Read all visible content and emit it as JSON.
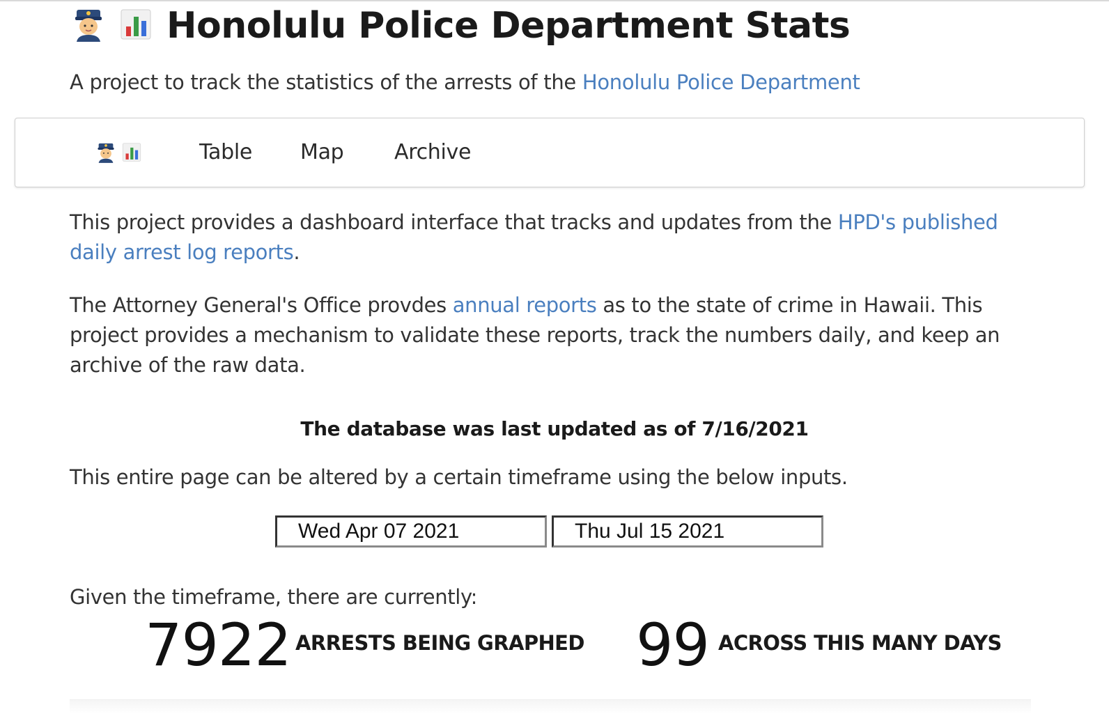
{
  "header": {
    "title": "Honolulu Police Department Stats",
    "icons": [
      "police-officer-icon",
      "bar-chart-icon"
    ],
    "subtitle_prefix": "A project to track the statistics of the arrests of the ",
    "subtitle_link": "Honolulu Police Department"
  },
  "nav": {
    "brand_icons": [
      "police-officer-icon",
      "bar-chart-icon"
    ],
    "items": [
      {
        "label": "Table"
      },
      {
        "label": "Map"
      },
      {
        "label": "Archive"
      }
    ]
  },
  "intro": {
    "p1_prefix": "This project provides a dashboard interface that tracks and updates from the ",
    "p1_link": "HPD's published daily arrest log reports",
    "p1_suffix": ".",
    "p2_prefix": "The Attorney General's Office provdes ",
    "p2_link": "annual reports",
    "p2_suffix": " as to the state of crime in Hawaii. This project provides a mechanism to validate these reports, track the numbers daily, and keep an archive of the raw data."
  },
  "status": {
    "updated_text": "The database was last updated as of 7/16/2021",
    "alter_text": "This entire page can be altered by a certain timeframe using the below inputs."
  },
  "timeframe": {
    "start_value": "Wed Apr 07 2021",
    "end_value": "Thu Jul 15 2021"
  },
  "summary": {
    "given_text": "Given the timeframe, there are currently:",
    "arrests_count": "7922",
    "arrests_label": "ARRESTS BEING GRAPHED",
    "days_count": "99",
    "days_label": "ACROSS THIS MANY DAYS"
  },
  "colors": {
    "link": "#4a7fbf",
    "text": "#333333",
    "heading": "#1a1a1a"
  }
}
